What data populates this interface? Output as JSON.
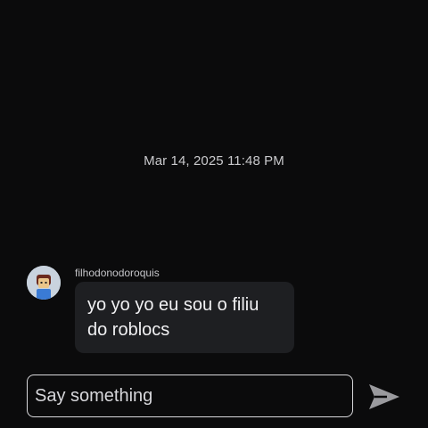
{
  "chat": {
    "timestamp": "Mar 14, 2025 11:48 PM",
    "messages": [
      {
        "username": "filhodonodoroquis",
        "text": "yo yo yo eu sou o filiu do roblocs"
      }
    ]
  },
  "composer": {
    "placeholder": "Say something",
    "send_icon": "send-arrow-icon"
  },
  "colors": {
    "background": "#0b0b0c",
    "bubble": "#1e1f22",
    "text": "#f1f1f3",
    "muted_text": "#c9c9cc",
    "send_icon": "#9a9a9e"
  }
}
